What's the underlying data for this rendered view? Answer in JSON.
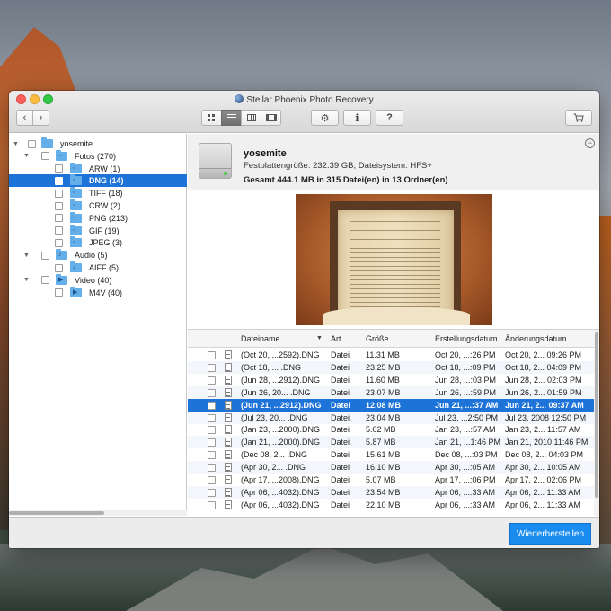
{
  "window": {
    "title": "Stellar Phoenix Photo Recovery"
  },
  "toolbar": {
    "info_label": "i",
    "help_label": "?"
  },
  "tree": [
    {
      "label": "yosemite",
      "level": 0,
      "expanded": true,
      "icon": "folder-icon"
    },
    {
      "label": "Fotos (270)",
      "level": 1,
      "expanded": true,
      "icon": "photo-folder-icon"
    },
    {
      "label": "ARW (1)",
      "level": 2,
      "icon": "photo-folder-icon"
    },
    {
      "label": "DNG (14)",
      "level": 2,
      "icon": "photo-folder-icon",
      "selected": true
    },
    {
      "label": "TIFF (18)",
      "level": 2,
      "icon": "photo-folder-icon"
    },
    {
      "label": "CRW (2)",
      "level": 2,
      "icon": "photo-folder-icon"
    },
    {
      "label": "PNG (213)",
      "level": 2,
      "icon": "photo-folder-icon"
    },
    {
      "label": "GIF (19)",
      "level": 2,
      "icon": "photo-folder-icon"
    },
    {
      "label": "JPEG (3)",
      "level": 2,
      "icon": "photo-folder-icon"
    },
    {
      "label": "Audio (5)",
      "level": 1,
      "expanded": true,
      "icon": "audio-folder-icon"
    },
    {
      "label": "AIFF (5)",
      "level": 2,
      "icon": "audio-folder-icon"
    },
    {
      "label": "Video (40)",
      "level": 1,
      "expanded": true,
      "icon": "video-folder-icon"
    },
    {
      "label": "M4V (40)",
      "level": 2,
      "icon": "video-folder-icon"
    }
  ],
  "info": {
    "volume_name": "yosemite",
    "size_text": "Festplattengröße: 232.39 GB, Dateisystem: HFS+",
    "total_text": "Gesamt 444.1 MB in 315 Datei(en) in 13 Ordner(en)"
  },
  "table": {
    "headers": {
      "name": "Dateiname",
      "type": "Art",
      "size": "Größe",
      "created": "Erstellungsdatum",
      "modified": "Änderungsdatum"
    },
    "rows": [
      {
        "name": "(Oct 20, ...2592).DNG",
        "type": "Datei",
        "size": "11.31 MB",
        "created": "Oct 20, ...:26 PM",
        "modified": "Oct 20, 2... 09:26 PM"
      },
      {
        "name": "(Oct 18, ...          .DNG",
        "type": "Datei",
        "size": "23.25 MB",
        "created": "Oct 18, ...:09 PM",
        "modified": "Oct 18, 2... 04:09 PM"
      },
      {
        "name": "(Jun 28, ...2912).DNG",
        "type": "Datei",
        "size": "11.60 MB",
        "created": "Jun 28, ...:03 PM",
        "modified": "Jun 28, 2... 02:03 PM"
      },
      {
        "name": "(Jun 26, 20...          .DNG",
        "type": "Datei",
        "size": "23.07 MB",
        "created": "Jun 26, ...:59 PM",
        "modified": "Jun 26, 2... 01:59 PM"
      },
      {
        "name": "(Jun 21, ...2912).DNG",
        "type": "Datei",
        "size": "12.08 MB",
        "created": "Jun 21, ...:37 AM",
        "modified": "Jun 21, 2... 09:37 AM",
        "selected": true
      },
      {
        "name": "(Jul 23, 20...          .DNG",
        "type": "Datei",
        "size": "23.04 MB",
        "created": "Jul 23, ...2:50 PM",
        "modified": "Jul 23, 2008 12:50 PM"
      },
      {
        "name": "(Jan 23, ...2000).DNG",
        "type": "Datei",
        "size": "5.02 MB",
        "created": "Jan 23, ...:57 AM",
        "modified": "Jan 23, 2... 11:57 AM"
      },
      {
        "name": "(Jan 21, ...2000).DNG",
        "type": "Datei",
        "size": "5.87 MB",
        "created": "Jan 21, ...1:46 PM",
        "modified": "Jan 21, 2010 11:46 PM"
      },
      {
        "name": "(Dec 08, 2...          .DNG",
        "type": "Datei",
        "size": "15.61 MB",
        "created": "Dec 08, ...:03 PM",
        "modified": "Dec 08, 2... 04:03 PM"
      },
      {
        "name": "(Apr 30, 2...          .DNG",
        "type": "Datei",
        "size": "16.10 MB",
        "created": "Apr 30, ...:05 AM",
        "modified": "Apr 30, 2... 10:05 AM"
      },
      {
        "name": "(Apr 17, ...2008).DNG",
        "type": "Datei",
        "size": "5.07 MB",
        "created": "Apr 17, ...:06 PM",
        "modified": "Apr 17, 2... 02:06 PM"
      },
      {
        "name": "(Apr 06, ...4032).DNG",
        "type": "Datei",
        "size": "23.54 MB",
        "created": "Apr 06, ...:33 AM",
        "modified": "Apr 06, 2... 11:33 AM"
      },
      {
        "name": "(Apr 06, ...4032).DNG",
        "type": "Datei",
        "size": "22.10 MB",
        "created": "Apr 06, ...:33 AM",
        "modified": "Apr 06, 2... 11:33 AM"
      }
    ]
  },
  "footer": {
    "recover_label": "Wiederherstellen"
  },
  "colors": {
    "selection": "#1e73d9",
    "recover_button": "#1a8cf0",
    "folder": "#64aee9"
  }
}
